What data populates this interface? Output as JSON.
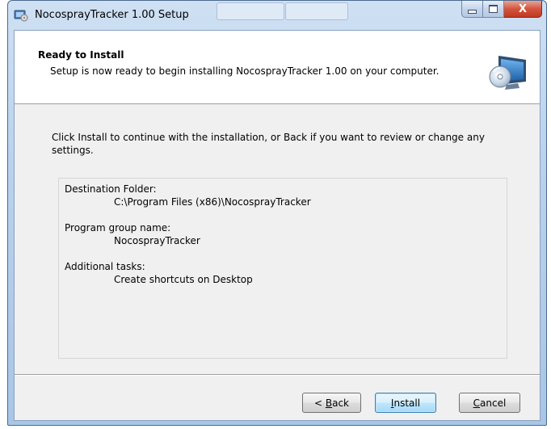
{
  "window": {
    "title": "NocosprayTracker 1.00 Setup",
    "close_glyph": "X"
  },
  "header": {
    "title": "Ready to Install",
    "subtitle": "Setup is now ready to begin installing NocosprayTracker 1.00 on your computer.",
    "icon": "computer-disc-icon"
  },
  "intro": "Click Install to continue with the installation, or Back if you want to review or change any settings.",
  "summary": {
    "destination_label": "Destination Folder:",
    "destination_value": "C:\\Program Files (x86)\\NocosprayTracker",
    "group_label": "Program group name:",
    "group_value": "NocosprayTracker",
    "tasks_label": "Additional tasks:",
    "tasks_value": "Create shortcuts on Desktop"
  },
  "buttons": {
    "back_prefix": "< ",
    "back_mnemonic": "B",
    "back_rest": "ack",
    "install_mnemonic": "I",
    "install_rest": "nstall",
    "cancel_mnemonic": "C",
    "cancel_rest": "ancel"
  },
  "colors": {
    "title_bar": "#b9d1ec",
    "close_button": "#c0391f",
    "default_button_border": "#3c7fb1"
  }
}
